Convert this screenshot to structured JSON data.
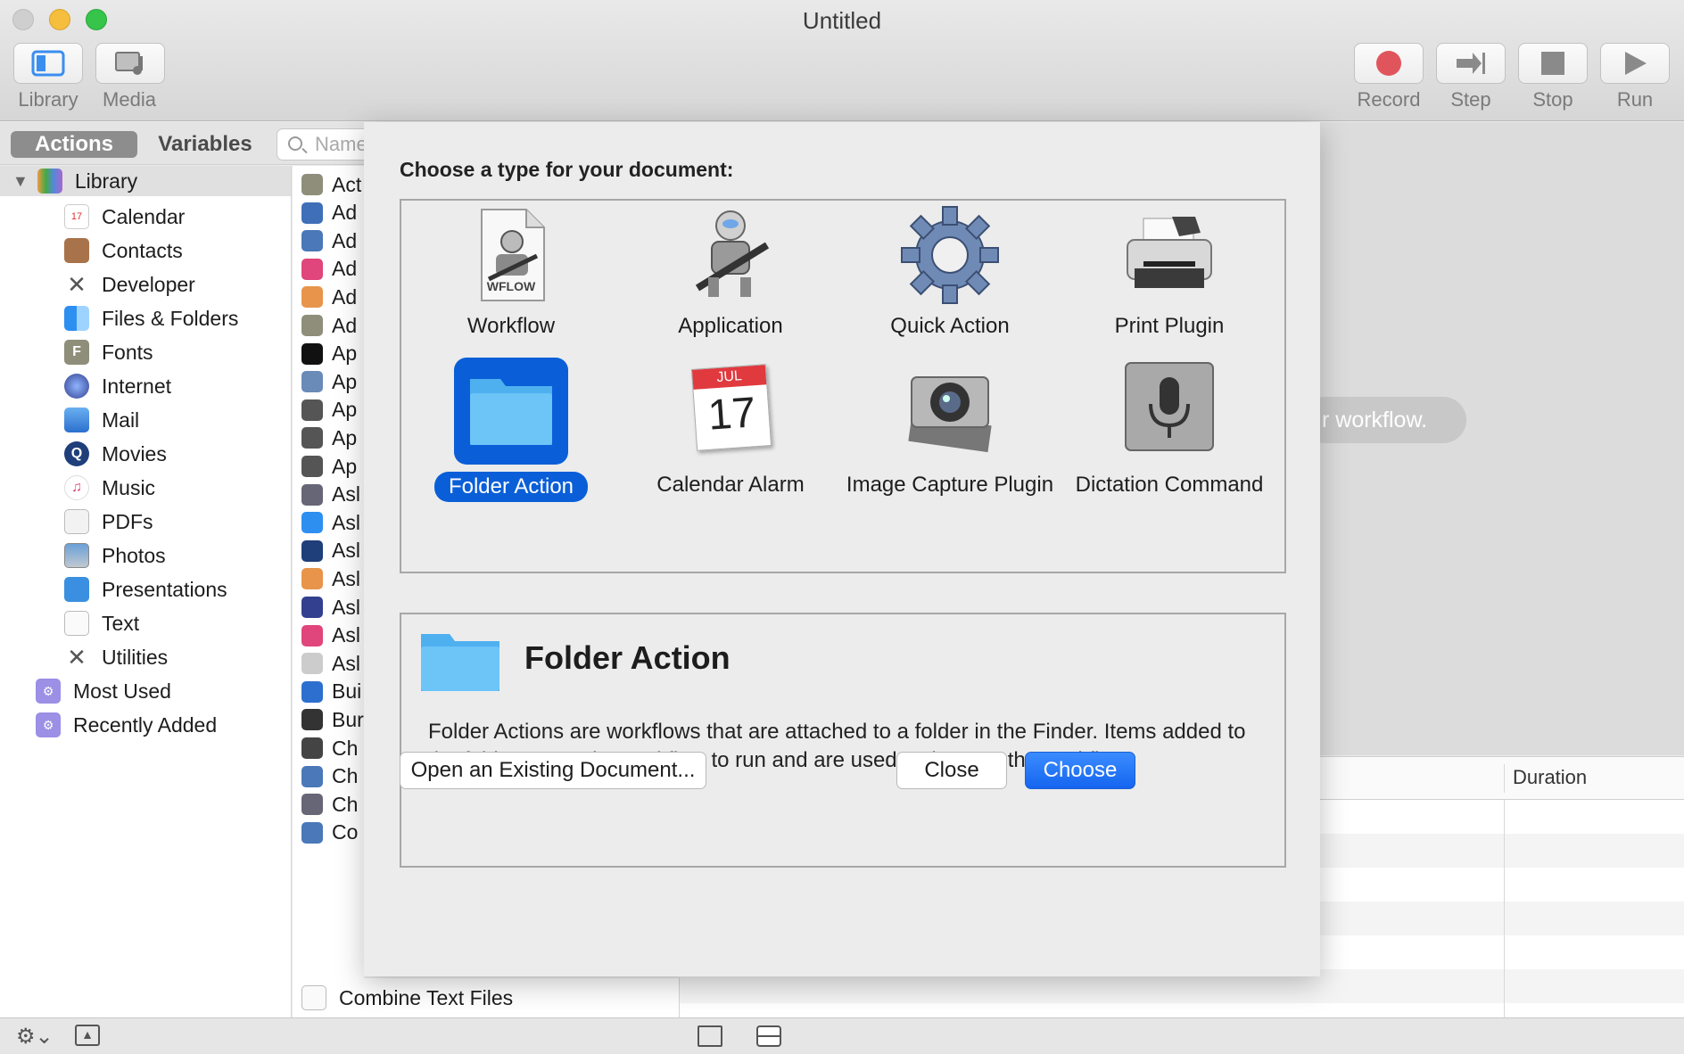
{
  "window": {
    "title": "Untitled"
  },
  "toolbar": {
    "library_label": "Library",
    "media_label": "Media",
    "record_label": "Record",
    "step_label": "Step",
    "stop_label": "Stop",
    "run_label": "Run"
  },
  "sidebar": {
    "tab_actions": "Actions",
    "tab_variables": "Variables",
    "search_placeholder": "Name",
    "root": "Library",
    "items": [
      {
        "label": "Calendar",
        "icon": "calendar-icon"
      },
      {
        "label": "Contacts",
        "icon": "contacts-icon"
      },
      {
        "label": "Developer",
        "icon": "developer-icon"
      },
      {
        "label": "Files & Folders",
        "icon": "finder-icon"
      },
      {
        "label": "Fonts",
        "icon": "fonts-icon"
      },
      {
        "label": "Internet",
        "icon": "globe-icon"
      },
      {
        "label": "Mail",
        "icon": "mail-icon"
      },
      {
        "label": "Movies",
        "icon": "quicktime-icon"
      },
      {
        "label": "Music",
        "icon": "music-icon"
      },
      {
        "label": "PDFs",
        "icon": "pdf-icon"
      },
      {
        "label": "Photos",
        "icon": "photos-icon"
      },
      {
        "label": "Presentations",
        "icon": "keynote-icon"
      },
      {
        "label": "Text",
        "icon": "text-icon"
      },
      {
        "label": "Utilities",
        "icon": "utilities-icon"
      }
    ],
    "smart_groups": [
      "Most Used",
      "Recently Added"
    ]
  },
  "actions_list": {
    "rows": [
      "Act",
      "Ad",
      "Ad",
      "Ad",
      "Ad",
      "Ad",
      "Ap",
      "Ap",
      "Ap",
      "Ap",
      "Ap",
      "Asl",
      "Asl",
      "Asl",
      "Asl",
      "Asl",
      "Asl",
      "Asl",
      "Bui",
      "Bur",
      "Ch",
      "Ch",
      "Ch",
      "Co"
    ],
    "last_row": "Combine Text Files"
  },
  "canvas": {
    "hint": "r workflow."
  },
  "log": {
    "duration_header": "Duration"
  },
  "sheet": {
    "title": "Choose a type for your document:",
    "types": [
      {
        "label": "Workflow",
        "selected": false,
        "icon": "workflow-file-icon",
        "badge": "WFLOW"
      },
      {
        "label": "Application",
        "selected": false,
        "icon": "automator-robot-icon"
      },
      {
        "label": "Quick Action",
        "selected": false,
        "icon": "gear-icon"
      },
      {
        "label": "Print Plugin",
        "selected": false,
        "icon": "printer-icon"
      },
      {
        "label": "Folder Action",
        "selected": true,
        "icon": "folder-icon"
      },
      {
        "label": "Calendar Alarm",
        "selected": false,
        "icon": "calendar-icon",
        "month": "JUL",
        "day": "17"
      },
      {
        "label": "Image Capture Plugin",
        "selected": false,
        "icon": "camera-icon"
      },
      {
        "label": "Dictation Command",
        "selected": false,
        "icon": "microphone-icon"
      }
    ],
    "detail_title": "Folder Action",
    "detail_text": "Folder Actions are workflows that are attached to a folder in the Finder. Items added to the folder cause the workflow to run and are used as input to the workflow.",
    "open_existing": "Open an Existing Document...",
    "close": "Close",
    "choose": "Choose"
  },
  "colors": {
    "accent": "#0a5fd8",
    "folder": "#5fbcf5",
    "record": "#e0555b"
  }
}
